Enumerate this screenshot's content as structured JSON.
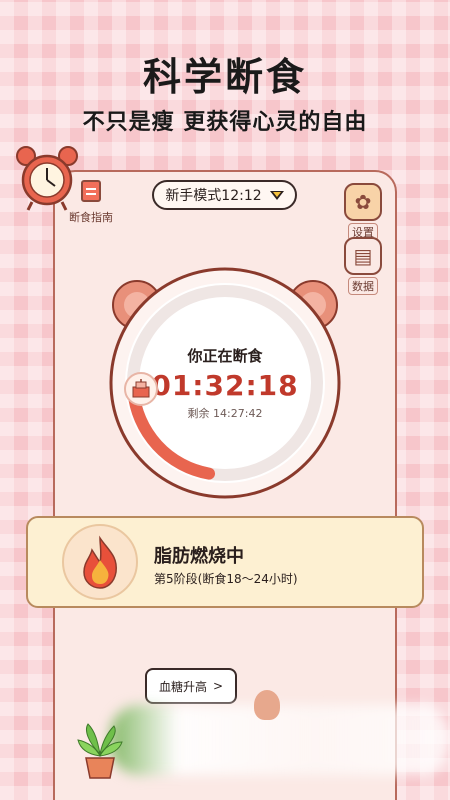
{
  "hero": {
    "title": "科学断食",
    "subtitle": "不只是瘦 更获得心灵的自由"
  },
  "topbar": {
    "guide_label": "断食指南",
    "mode_label": "新手模式12:12",
    "settings_label": "设置",
    "data_label": "数据"
  },
  "timer": {
    "status": "你正在断食",
    "elapsed": "01:32:18",
    "remaining": "剩余 14:27:42",
    "progress_fraction": 0.106
  },
  "stage": {
    "title": "脂肪燃烧中",
    "detail": "第5阶段(断食18～24小时)"
  },
  "bottom": {
    "sugar_button": "血糖升高",
    "chevron": ">"
  },
  "colors": {
    "background": "#f7c6cb",
    "card": "#fbe9e5",
    "accent": "#e8654f",
    "time": "#c0392b"
  }
}
